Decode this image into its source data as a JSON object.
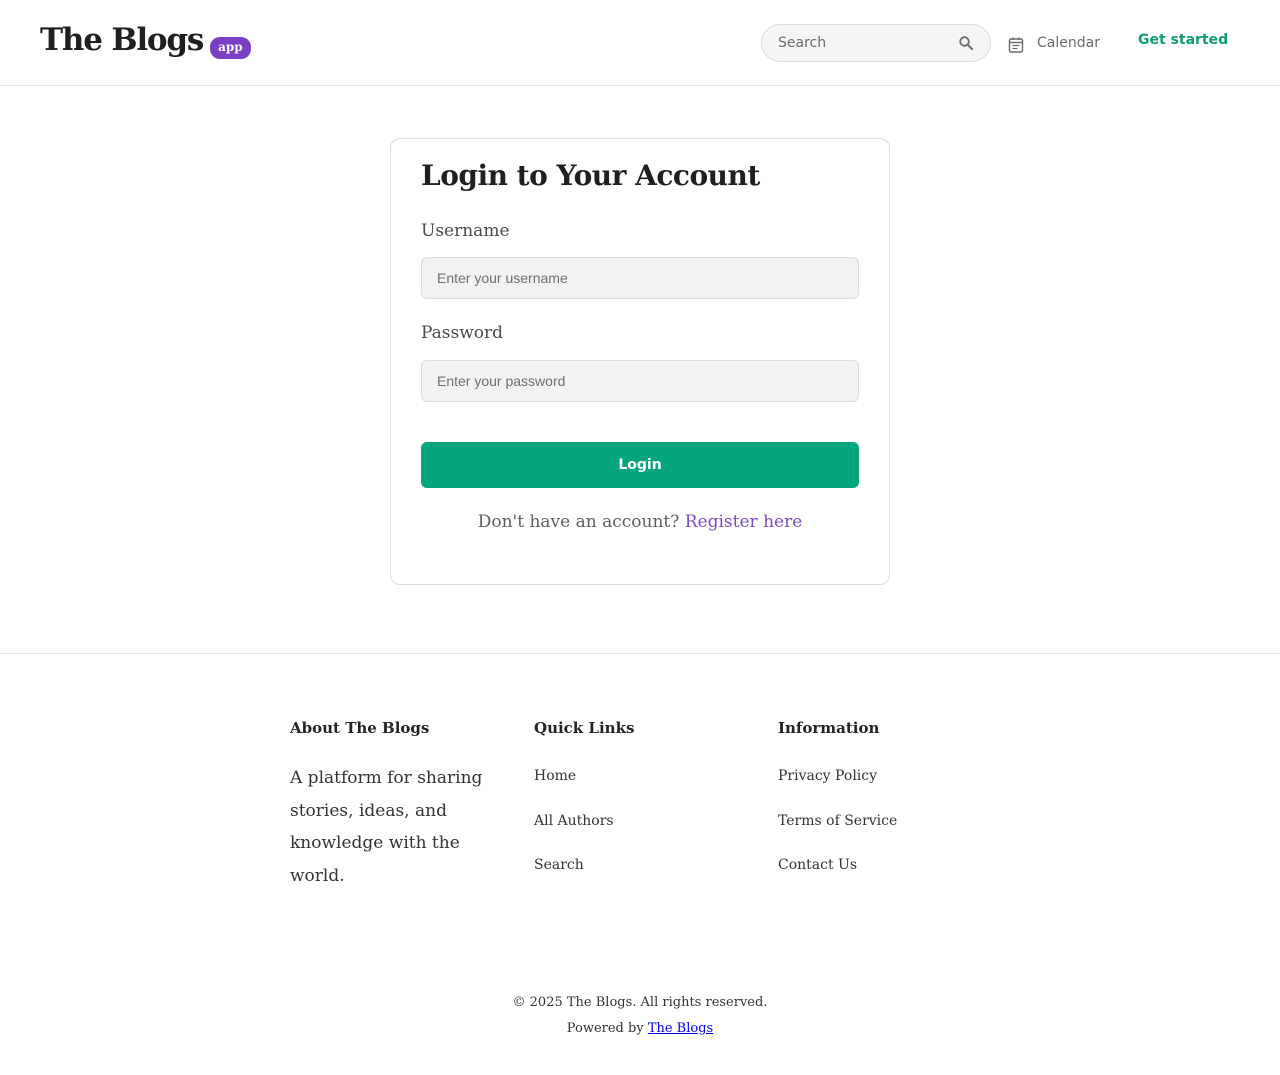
{
  "header": {
    "logo_text": "The Blogs",
    "logo_badge": "app",
    "search_placeholder": "Search",
    "calendar_label": "Calendar",
    "get_started_label": "Get started"
  },
  "login": {
    "title": "Login to Your Account",
    "username_label": "Username",
    "username_placeholder": "Enter your username",
    "password_label": "Password",
    "password_placeholder": "Enter your password",
    "login_button": "Login",
    "register_prompt": "Don't have an account?",
    "register_link": "Register here"
  },
  "footer": {
    "about": {
      "heading": "About The Blogs",
      "text": "A platform for sharing stories, ideas, and knowledge with the world."
    },
    "quick_links": {
      "heading": "Quick Links",
      "items": [
        "Home",
        "All Authors",
        "Search"
      ]
    },
    "information": {
      "heading": "Information",
      "items": [
        "Privacy Policy",
        "Terms of Service",
        "Contact Us"
      ]
    },
    "copyright": "© 2025 The Blogs. All rights reserved.",
    "powered_prefix": "Powered by",
    "powered_link": "The Blogs"
  },
  "colors": {
    "brand_badge": "#7b3fc4",
    "accent_green": "#05a67e",
    "link_purple": "#7b4cc4"
  },
  "icons": {
    "search": "search-icon",
    "calendar": "calendar-icon"
  }
}
